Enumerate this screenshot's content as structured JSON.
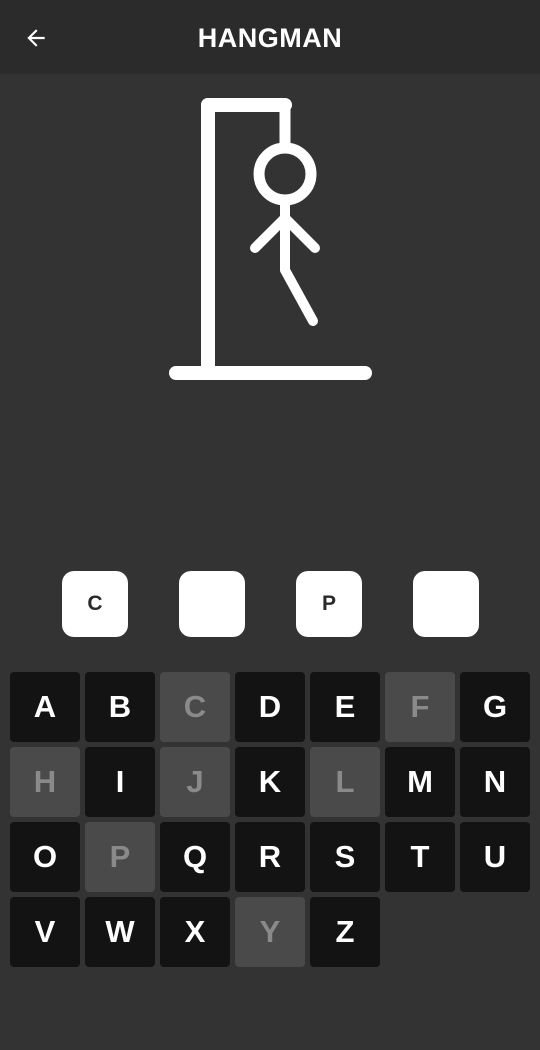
{
  "app_bar": {
    "title": "HANGMAN",
    "back_icon": "arrow-left-icon"
  },
  "word": {
    "slots": [
      "C",
      "",
      "P",
      ""
    ]
  },
  "keyboard": {
    "keys": [
      {
        "letter": "A",
        "used": false
      },
      {
        "letter": "B",
        "used": false
      },
      {
        "letter": "C",
        "used": true
      },
      {
        "letter": "D",
        "used": false
      },
      {
        "letter": "E",
        "used": false
      },
      {
        "letter": "F",
        "used": true
      },
      {
        "letter": "G",
        "used": false
      },
      {
        "letter": "H",
        "used": true
      },
      {
        "letter": "I",
        "used": false
      },
      {
        "letter": "J",
        "used": true
      },
      {
        "letter": "K",
        "used": false
      },
      {
        "letter": "L",
        "used": true
      },
      {
        "letter": "M",
        "used": false
      },
      {
        "letter": "N",
        "used": false
      },
      {
        "letter": "O",
        "used": false
      },
      {
        "letter": "P",
        "used": true
      },
      {
        "letter": "Q",
        "used": false
      },
      {
        "letter": "R",
        "used": false
      },
      {
        "letter": "S",
        "used": false
      },
      {
        "letter": "T",
        "used": false
      },
      {
        "letter": "U",
        "used": false
      },
      {
        "letter": "V",
        "used": false
      },
      {
        "letter": "W",
        "used": false
      },
      {
        "letter": "X",
        "used": false
      },
      {
        "letter": "Y",
        "used": true
      },
      {
        "letter": "Z",
        "used": false
      }
    ]
  },
  "colors": {
    "background": "#333333",
    "app_bar": "#2b2b2b",
    "key_available": "#131313",
    "key_used": "#4a4a4a",
    "slot": "#ffffff"
  }
}
